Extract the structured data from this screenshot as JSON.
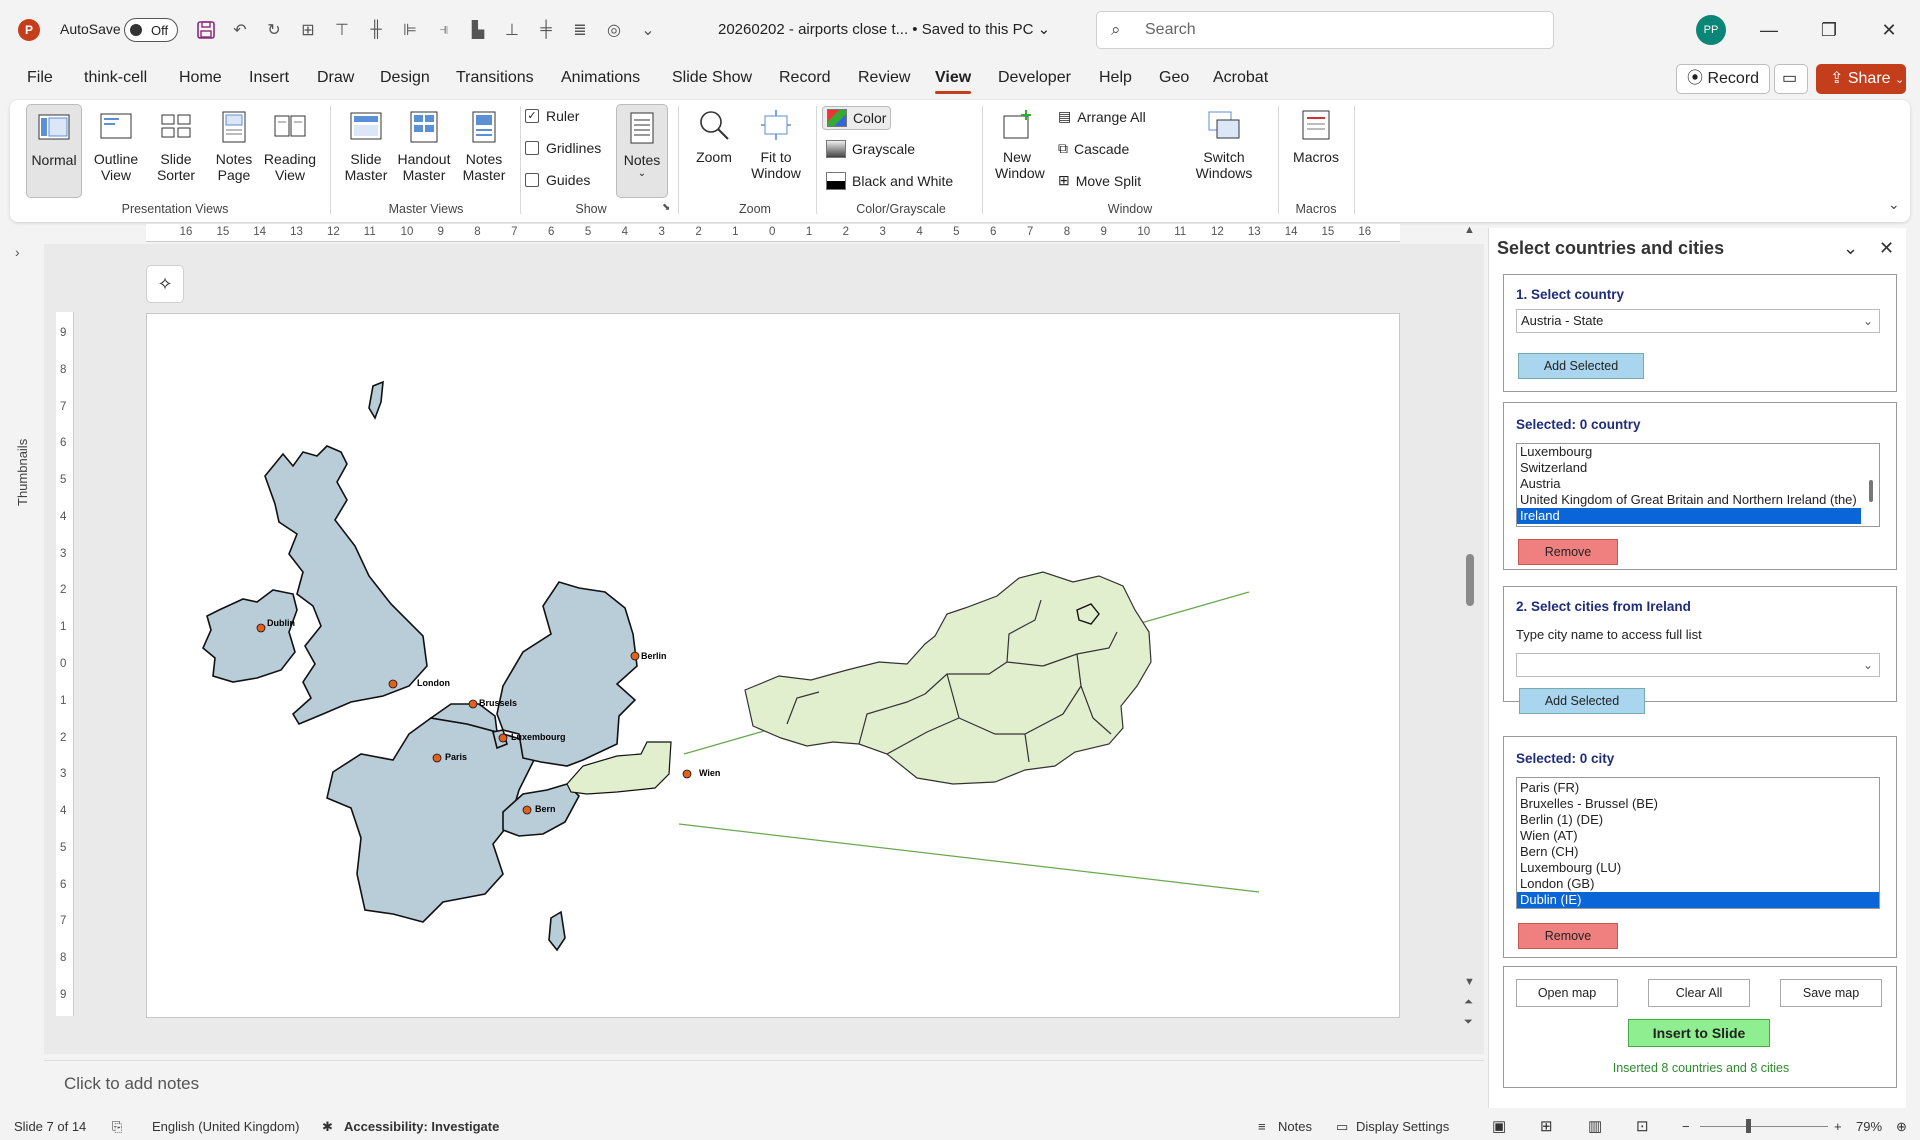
{
  "titlebar": {
    "app_logo": "P",
    "autosave_label": "AutoSave",
    "autosave_state": "Off",
    "document_title": "20260202 - airports close t...  •  Saved to this PC ⌄",
    "search_placeholder": "Search",
    "user_initials": "PP",
    "icons": [
      "save-icon",
      "undo-icon",
      "redo-icon",
      "presenter-icon",
      "align-icon",
      "align-icon",
      "align-icon",
      "align-icon",
      "chart-icon",
      "align-icon",
      "align-icon",
      "align-icon",
      "shapes-icon",
      "more-icon"
    ]
  },
  "tabs": [
    "File",
    "think-cell",
    "Home",
    "Insert",
    "Draw",
    "Design",
    "Transitions",
    "Animations",
    "Slide Show",
    "Record",
    "Review",
    "View",
    "Developer",
    "Help",
    "Geo",
    "Acrobat"
  ],
  "active_tab": "View",
  "header_buttons": {
    "record": "Record",
    "share": "Share"
  },
  "ribbon": {
    "presentation_views": {
      "label": "Presentation Views",
      "items": [
        "Normal",
        "Outline View",
        "Slide Sorter",
        "Notes Page",
        "Reading View"
      ]
    },
    "master_views": {
      "label": "Master Views",
      "items": [
        "Slide Master",
        "Handout Master",
        "Notes Master"
      ]
    },
    "show": {
      "label": "Show",
      "ruler": "Ruler",
      "gridlines": "Gridlines",
      "guides": "Guides",
      "notes": "Notes"
    },
    "zoom": {
      "label": "Zoom",
      "items": [
        "Zoom",
        "Fit to Window"
      ]
    },
    "color": {
      "label": "Color/Grayscale",
      "items": [
        "Color",
        "Grayscale",
        "Black and White"
      ]
    },
    "window": {
      "label": "Window",
      "new_window": "New Window",
      "items": [
        "Arrange All",
        "Cascade",
        "Move Split"
      ],
      "switch": "Switch Windows"
    },
    "macros": {
      "label": "Macros",
      "item": "Macros"
    }
  },
  "thumbnails_label": "Thumbnails",
  "ruler": {
    "h_ticks": [
      "16",
      "15",
      "14",
      "13",
      "12",
      "11",
      "10",
      "9",
      "8",
      "7",
      "6",
      "5",
      "4",
      "3",
      "2",
      "1",
      "0",
      "1",
      "2",
      "3",
      "4",
      "5",
      "6",
      "7",
      "8",
      "9",
      "10",
      "11",
      "12",
      "13",
      "14",
      "15",
      "16"
    ],
    "v_ticks": [
      "9",
      "8",
      "7",
      "6",
      "5",
      "4",
      "3",
      "2",
      "1",
      "0",
      "1",
      "2",
      "3",
      "4",
      "5",
      "6",
      "7",
      "8",
      "9"
    ]
  },
  "map": {
    "cities": [
      "Dublin",
      "London",
      "Brussels",
      "Luxembourg",
      "Paris",
      "Berlin",
      "Bern",
      "Wien"
    ],
    "country_fill": "#b9cdd9",
    "highlight_fill": "#e2efcf",
    "city_dot": "#e0601c"
  },
  "notes_placeholder": "Click to add notes",
  "pane": {
    "title": "Select countries and cities",
    "step1_title": "1. Select country",
    "country_combo_value": "Austria - State",
    "add_selected": "Add Selected",
    "selected_countries_title": "Selected: 0 country",
    "selected_countries": [
      "Luxembourg",
      "Switzerland",
      "Austria",
      "United Kingdom of Great Britain and Northern Ireland (the)",
      "Ireland"
    ],
    "selected_country_highlight": "Ireland",
    "remove": "Remove",
    "step2_title": "2. Select cities from Ireland",
    "city_hint": "Type city name to access full list",
    "city_combo_value": "",
    "selected_cities_title": "Selected: 0 city",
    "selected_cities": [
      "Paris (FR)",
      "Bruxelles - Brussel (BE)",
      "Berlin (1) (DE)",
      "Wien (AT)",
      "Bern (CH)",
      "Luxembourg (LU)",
      "London (GB)",
      "Dublin (IE)"
    ],
    "selected_city_highlight": "Dublin (IE)",
    "open_map": "Open map",
    "clear_all": "Clear All",
    "save_map": "Save map",
    "insert_to_slide": "Insert to Slide",
    "inserted_message": "Inserted 8 countries and 8 cities"
  },
  "status": {
    "slide": "Slide 7 of 14",
    "language": "English (United Kingdom)",
    "accessibility": "Accessibility: Investigate",
    "notes": "Notes",
    "display_settings": "Display Settings",
    "zoom": "79%"
  }
}
